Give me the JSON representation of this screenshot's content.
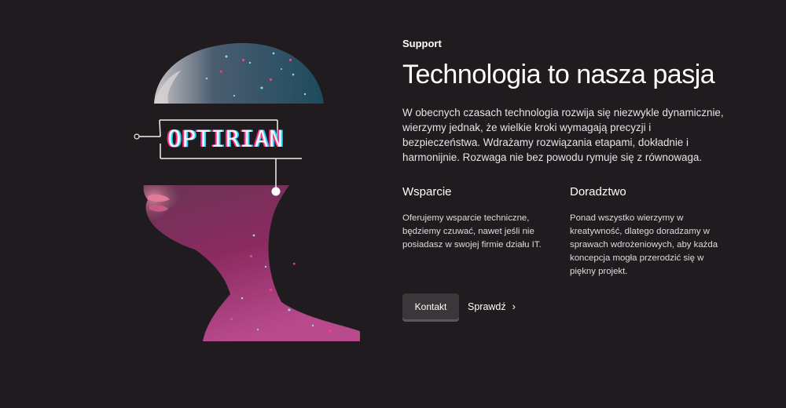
{
  "hero": {
    "logo_text": "OPTIRIAN",
    "colors": {
      "accent_pink": "#ff2e88",
      "accent_cyan": "#29d3ff",
      "background": "#1f1b1e"
    }
  },
  "content": {
    "eyebrow": "Support",
    "title": "Technologia to nasza pasja",
    "lead": "W obecnych czasach technologia rozwija się niezwykle dynamicznie, wierzymy jednak, że wielkie kroki wymagają precyzji i bezpieczeństwa. Wdrażamy rozwiązania etapami, dokładnie i harmonijnie. Rozwaga nie bez powodu rymuje się z równowaga.",
    "features": [
      {
        "title": "Wsparcie",
        "text": "Oferujemy wsparcie techniczne, będziemy czuwać, nawet jeśli nie posiadasz w swojej firmie działu IT."
      },
      {
        "title": "Doradztwo",
        "text": "Ponad wszystko wierzymy w kreatywność, dlatego doradzamy w sprawach wdrożeniowych, aby każda koncepcja mogła przerodzić się w piękny projekt."
      }
    ]
  },
  "actions": {
    "primary_label": "Kontakt",
    "secondary_label": "Sprawdź",
    "secondary_icon": "chevron-right-icon",
    "secondary_glyph": "›"
  }
}
